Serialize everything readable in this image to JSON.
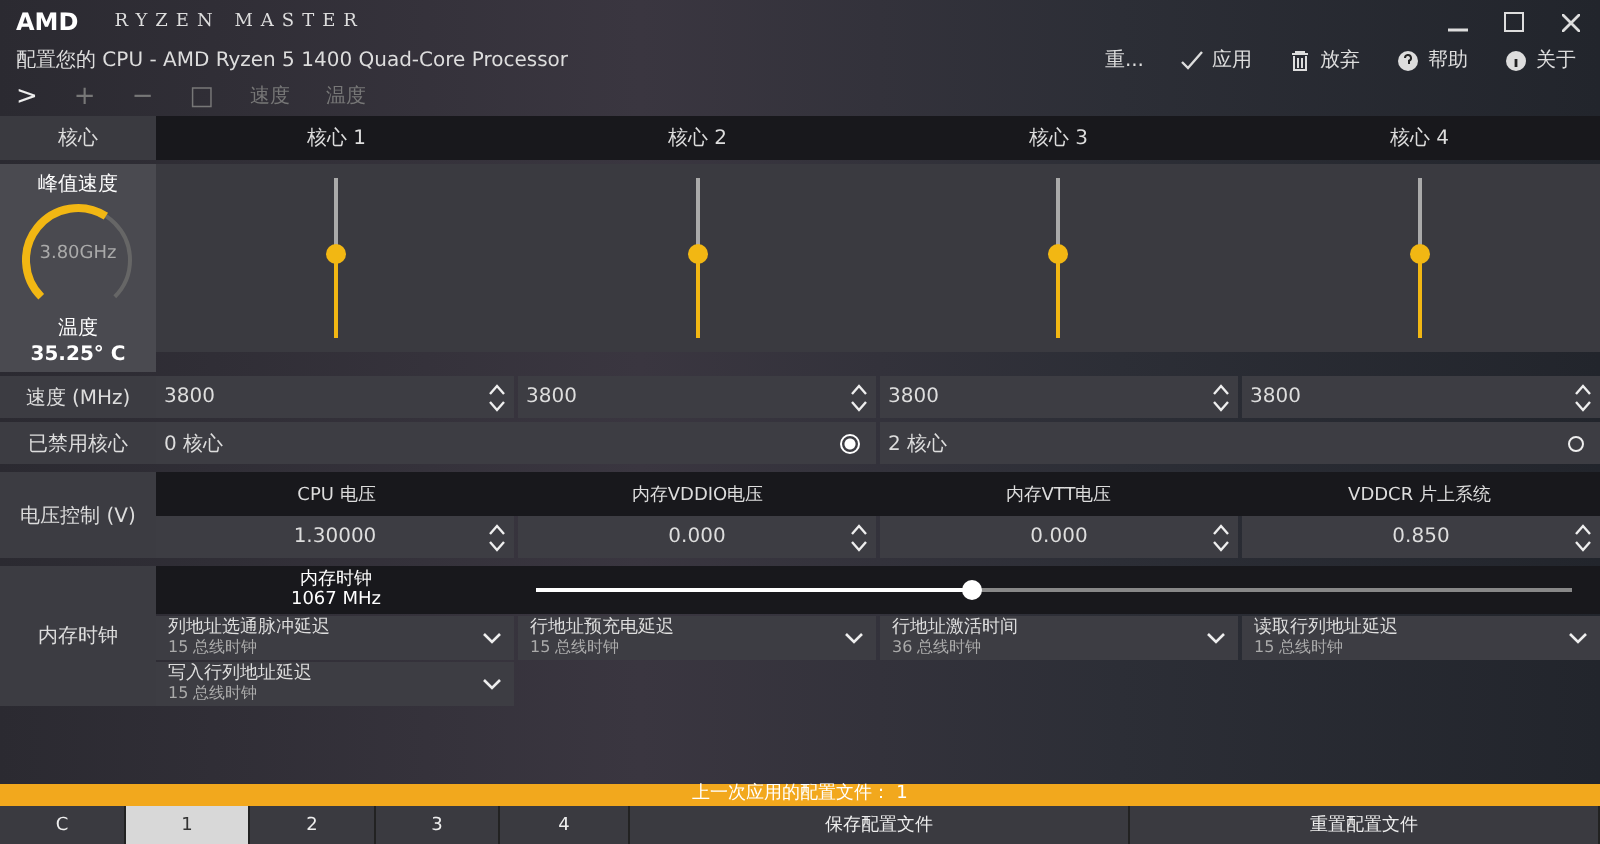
{
  "window": {
    "logo": "AMD",
    "title": "RYZEN MASTER",
    "subtitle": "配置您的 CPU - AMD Ryzen 5 1400 Quad-Core Processor"
  },
  "actions": [
    {
      "label": "重...",
      "kind": "text"
    },
    {
      "label": "应用",
      "kind": "check"
    },
    {
      "label": "放弃",
      "kind": "trash"
    },
    {
      "label": "帮助",
      "kind": "help"
    },
    {
      "label": "关于",
      "kind": "info"
    }
  ],
  "toolbar": [
    {
      "label": ">",
      "kind": "glyph"
    },
    {
      "label": "+",
      "kind": "glyph"
    },
    {
      "label": "−",
      "kind": "glyph"
    },
    {
      "label": "□",
      "kind": "glyph"
    },
    {
      "label": "速度",
      "kind": "text"
    },
    {
      "label": "温度",
      "kind": "text"
    }
  ],
  "cores_header": "核心",
  "cores": [
    {
      "name": "核心 1",
      "level": 0.52
    },
    {
      "name": "核心 2",
      "level": 0.52
    },
    {
      "name": "核心 3",
      "level": 0.52
    },
    {
      "name": "核心 4",
      "level": 0.52
    }
  ],
  "gauge": {
    "title": "峰值速度",
    "value": "3.80GHz",
    "level": 0.62,
    "temp_label": "温度",
    "temp": "35.25° C"
  },
  "speed": {
    "label": "速度 (MHz)",
    "values": [
      "3800",
      "3800",
      "3800",
      "3800"
    ]
  },
  "disabled": {
    "label": "已禁用核心",
    "options": [
      {
        "label": "0 核心",
        "selected": true
      },
      {
        "label": "2 核心",
        "selected": false
      }
    ]
  },
  "voltage": {
    "label": "电压控制 (V)",
    "items": [
      {
        "name": "CPU 电压",
        "value": "1.30000"
      },
      {
        "name": "内存VDDIO电压",
        "value": "0.000"
      },
      {
        "name": "内存VTT电压",
        "value": "0.000"
      },
      {
        "name": "VDDCR 片上系统",
        "value": "0.850"
      }
    ]
  },
  "memory": {
    "label": "内存时钟",
    "clock_label": "内存时钟",
    "clock": "1067 MHz",
    "level": 0.42,
    "timings": [
      {
        "name": "列地址选通脉冲延迟",
        "value": "15 总线时钟"
      },
      {
        "name": "行地址预充电延迟",
        "value": "15 总线时钟"
      },
      {
        "name": "行地址激活时间",
        "value": "36 总线时钟"
      },
      {
        "name": "读取行列地址延迟",
        "value": "15 总线时钟"
      },
      {
        "name": "写入行列地址延迟",
        "value": "15 总线时钟"
      }
    ]
  },
  "status": "上一次应用的配置文件： 1",
  "profiles": [
    {
      "label": "C",
      "selected": false
    },
    {
      "label": "1",
      "selected": true
    },
    {
      "label": "2",
      "selected": false
    },
    {
      "label": "3",
      "selected": false
    },
    {
      "label": "4",
      "selected": false
    }
  ],
  "buttons": [
    "保存配置文件",
    "重置配置文件"
  ]
}
